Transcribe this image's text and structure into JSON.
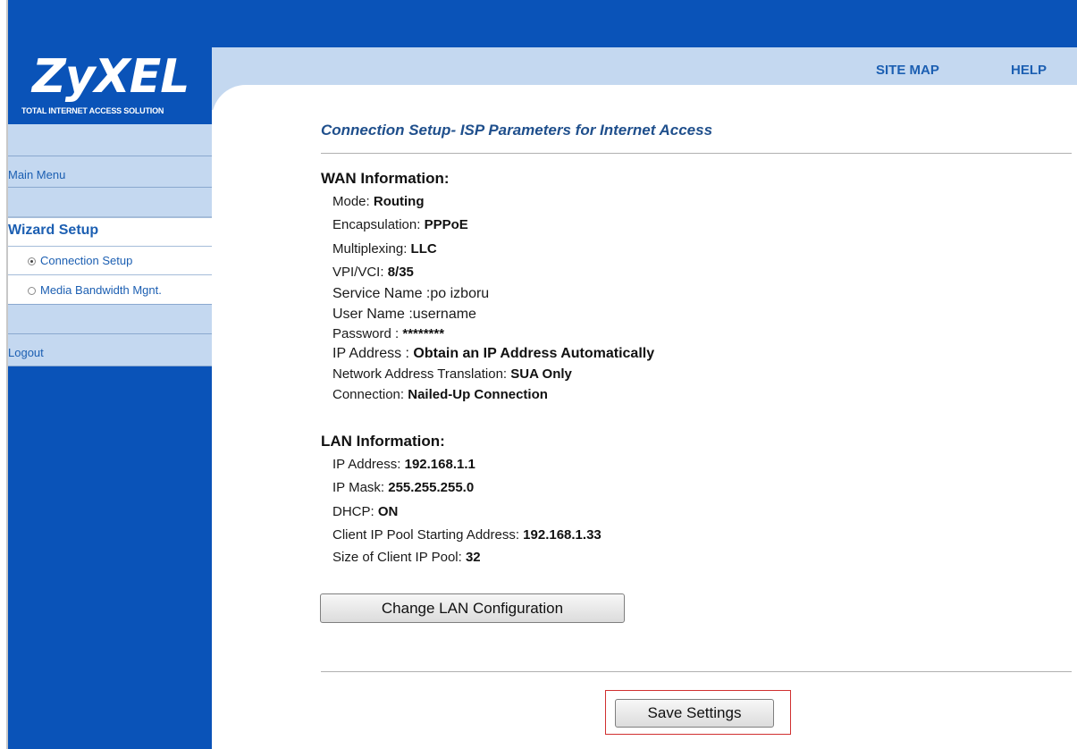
{
  "header": {
    "logo_text": "ZyXEL",
    "logo_subtitle": "Total Internet Access Solution",
    "site_map": "SITE MAP",
    "help": "HELP"
  },
  "sidebar": {
    "main_menu": "Main Menu",
    "wizard_setup": "Wizard Setup",
    "items": [
      {
        "label": "Connection Setup",
        "selected": true
      },
      {
        "label": "Media Bandwidth Mgnt.",
        "selected": false
      }
    ],
    "logout": "Logout"
  },
  "main": {
    "title": "Connection Setup- ISP Parameters for Internet Access",
    "wan": {
      "heading": "WAN Information:",
      "rows": [
        {
          "label": "Mode: ",
          "value": "Routing"
        },
        {
          "label": "Encapsulation: ",
          "value": "PPPoE"
        },
        {
          "label": "Multiplexing: ",
          "value": "LLC"
        },
        {
          "label": "VPI/VCI: ",
          "value": "8/35"
        },
        {
          "label": "Service Name :",
          "value": "po izboru"
        },
        {
          "label": "User Name :",
          "value": "username"
        },
        {
          "label": "Password : ",
          "value": "********"
        },
        {
          "label": "IP Address : ",
          "value": "Obtain an IP Address Automatically"
        },
        {
          "label": "Network Address Translation: ",
          "value": "SUA Only"
        },
        {
          "label": "Connection: ",
          "value": "Nailed-Up Connection"
        }
      ]
    },
    "lan": {
      "heading": "LAN Information:",
      "rows": [
        {
          "label": "IP Address: ",
          "value": "192.168.1.1"
        },
        {
          "label": "IP Mask: ",
          "value": "255.255.255.0"
        },
        {
          "label": "DHCP: ",
          "value": "ON"
        },
        {
          "label": "Client IP Pool Starting Address: ",
          "value": "192.168.1.33"
        },
        {
          "label": "Size of Client IP Pool: ",
          "value": "32"
        }
      ]
    },
    "change_lan_button": "Change LAN Configuration",
    "save_button": "Save Settings"
  },
  "colors": {
    "brand_blue": "#0a53b8",
    "light_blue": "#c4d8f0",
    "link_blue": "#1c5fb2",
    "highlight_red": "#d03030"
  }
}
